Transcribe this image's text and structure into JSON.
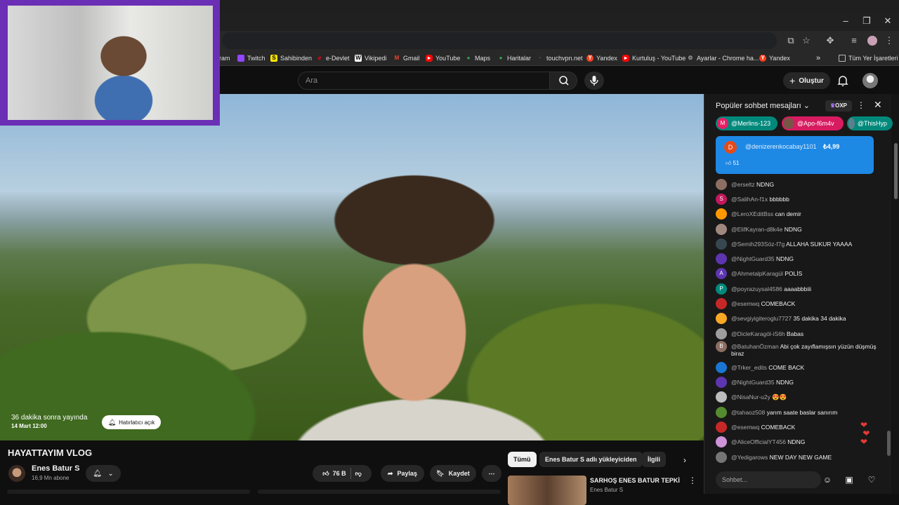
{
  "browser": {
    "bookmarks": [
      {
        "label": "ram",
        "icon": "",
        "color": ""
      },
      {
        "label": "Twitch",
        "icon": "twitch-icon",
        "color": "#9146ff"
      },
      {
        "label": "Sahibinden",
        "icon": "sahibinden-icon",
        "color": "#ffe800"
      },
      {
        "label": "e-Devlet",
        "icon": "edevlet-icon",
        "color": "#e30a17"
      },
      {
        "label": "Vikipedi",
        "icon": "wikipedia-icon",
        "color": "#ffffff"
      },
      {
        "label": "Gmail",
        "icon": "gmail-icon",
        "color": "#ea4335"
      },
      {
        "label": "YouTube",
        "icon": "youtube-icon",
        "color": "#ff0000"
      },
      {
        "label": "Maps",
        "icon": "maps-icon",
        "color": "#34a853"
      },
      {
        "label": "Haritalar",
        "icon": "maps-icon",
        "color": "#34a853"
      },
      {
        "label": "touchvpn.net",
        "icon": "globe-icon",
        "color": "#555555"
      },
      {
        "label": "Yandex",
        "icon": "yandex-icon",
        "color": "#fc3f1d"
      },
      {
        "label": "Kurtuluş - YouTube",
        "icon": "youtube-icon",
        "color": "#ff0000"
      },
      {
        "label": "Ayarlar - Chrome ha...",
        "icon": "gear-icon",
        "color": "#9aa0a6"
      },
      {
        "label": "Yandex",
        "icon": "yandex-icon",
        "color": "#fc3f1d"
      }
    ],
    "all_bookmarks": "Tüm Yer İşaretleri",
    "overflow": "»"
  },
  "youtube": {
    "search_placeholder": "Ara",
    "create_label": "Oluştur"
  },
  "video": {
    "remind_text": "36 dakika sonra yayında",
    "remind_date": "14 Mart 12:00",
    "remind_button": "Hatırlatıcı açık",
    "title": "HAYATTAYIM VLOG",
    "channel_name": "Enes Batur S",
    "channel_subs": "16,9 Mn abone",
    "likes": "76 B",
    "share": "Paylaş",
    "save": "Kaydet"
  },
  "chips": [
    "Tümü",
    "Enes Batur S adlı yükleyiciden",
    "İlgili"
  ],
  "recommendation": {
    "title": "SARHOŞ ENES BATUR TEPKİ",
    "channel": "Enes Batur S"
  },
  "chat": {
    "title": "Popüler sohbet mesajları",
    "oxp": "OXP",
    "pinned": [
      {
        "name": "@Merlins-123",
        "initial": "M",
        "color": "#e91e63",
        "bg": "#00897b"
      },
      {
        "name": "@Apo-f6m4v",
        "initial": "",
        "color": "#795548",
        "bg": "#d81b60"
      },
      {
        "name": "@ThisHyp",
        "initial": "",
        "color": "#607d8b",
        "bg": "#00897b"
      }
    ],
    "superchat": {
      "initial": "D",
      "name": "@denizerenkocabay1101",
      "amount": "₺4,99",
      "likes": "51"
    },
    "messages": [
      {
        "author": "@erseltz",
        "text": "NDNG",
        "initial": "",
        "color": "#8d6e63"
      },
      {
        "author": "@SalihAn-f1x",
        "text": "bbbbbb",
        "initial": "S",
        "color": "#c2185b"
      },
      {
        "author": "@LeroXEditBss",
        "text": "can demir",
        "initial": "",
        "color": "#ff9800"
      },
      {
        "author": "@ElifKayran-d8k4e",
        "text": "NDNG",
        "initial": "",
        "color": "#a1887f"
      },
      {
        "author": "@Semih293Söz-f7g",
        "text": "ALLAHA SUKUR YAAAA",
        "initial": "",
        "color": "#37474f"
      },
      {
        "author": "@NightGuard35",
        "text": "NDNG",
        "initial": "",
        "color": "#5e35b1"
      },
      {
        "author": "@AhmetalpKaragül",
        "text": "POLİS",
        "initial": "A",
        "color": "#5e35b1"
      },
      {
        "author": "@poyrazuysal4586",
        "text": "aaaabbbiii",
        "initial": "P",
        "color": "#00897b"
      },
      {
        "author": "@esemwq",
        "text": "COMEBACK",
        "initial": "",
        "color": "#c62828"
      },
      {
        "author": "@sevgiyigiteroglu7727",
        "text": "35 dakika 34 dakika",
        "initial": "",
        "color": "#f9a825"
      },
      {
        "author": "@DicleKaragöl-iS6h",
        "text": "Babas",
        "initial": "",
        "color": "#9e9e9e"
      },
      {
        "author": "@BatuhanÖzman",
        "text": "Abi çok zayıflamışsın yüzün düşmüş biraz",
        "initial": "B",
        "color": "#8d6e63"
      },
      {
        "author": "@Trker_edits",
        "text": "COME BACK",
        "initial": "",
        "color": "#1976d2"
      },
      {
        "author": "@NightGuard35",
        "text": "NDNG",
        "initial": "",
        "color": "#5e35b1"
      },
      {
        "author": "@NisaNur-u2y",
        "text": "😍😍",
        "initial": "",
        "color": "#bdbdbd"
      },
      {
        "author": "@tahaoz508",
        "text": "yarım saate baslar sanırım",
        "initial": "",
        "color": "#558b2f"
      },
      {
        "author": "@esemwq",
        "text": "COMEBACK",
        "initial": "",
        "color": "#c62828"
      },
      {
        "author": "@AliceOfficialYT456",
        "text": "NDNG",
        "initial": "",
        "color": "#ce93d8"
      },
      {
        "author": "@Yedigarows",
        "text": "NEW DAY NEW GAME",
        "initial": "",
        "color": "#757575"
      }
    ],
    "input_placeholder": "Sohbet..."
  }
}
